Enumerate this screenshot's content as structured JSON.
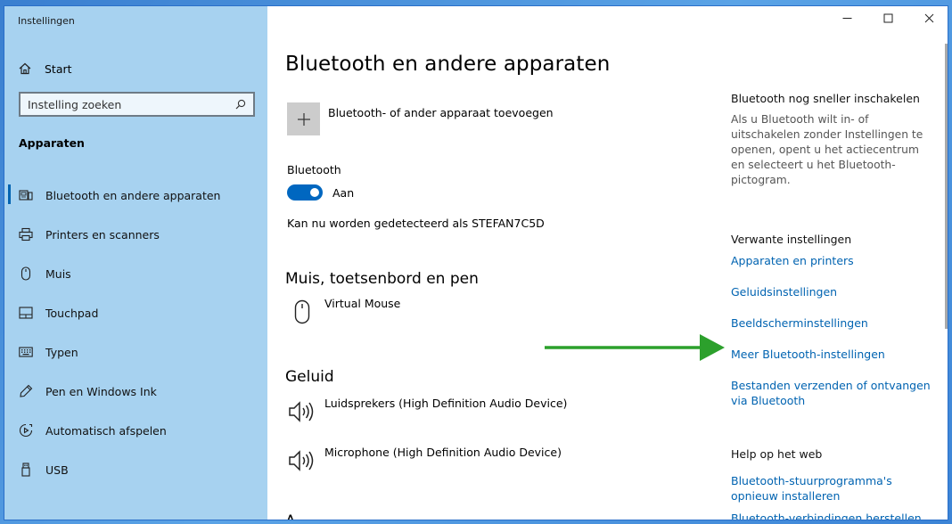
{
  "window": {
    "app_title": "Instellingen",
    "controls": {
      "minimize_icon": "minimize-icon",
      "maximize_icon": "maximize-icon",
      "close_icon": "close-icon"
    }
  },
  "sidebar": {
    "home_label": "Start",
    "search_placeholder": "Instelling zoeken",
    "section": "Apparaten",
    "items": [
      {
        "label": "Bluetooth en andere apparaten",
        "icon": "bluetooth-devices-icon",
        "active": true
      },
      {
        "label": "Printers en scanners",
        "icon": "printer-icon",
        "active": false
      },
      {
        "label": "Muis",
        "icon": "mouse-icon",
        "active": false
      },
      {
        "label": "Touchpad",
        "icon": "touchpad-icon",
        "active": false
      },
      {
        "label": "Typen",
        "icon": "keyboard-icon",
        "active": false
      },
      {
        "label": "Pen en Windows Ink",
        "icon": "pen-icon",
        "active": false
      },
      {
        "label": "Automatisch afspelen",
        "icon": "autoplay-icon",
        "active": false
      },
      {
        "label": "USB",
        "icon": "usb-icon",
        "active": false
      }
    ]
  },
  "main": {
    "title": "Bluetooth en andere apparaten",
    "add_device_label": "Bluetooth- of ander apparaat toevoegen",
    "bluetooth_label": "Bluetooth",
    "bluetooth_state": "Aan",
    "discoverable_text": "Kan nu worden gedetecteerd als STEFAN7C5D",
    "groups": {
      "input_title": "Muis, toetsenbord en pen",
      "input_devices": [
        "Virtual Mouse"
      ],
      "audio_title": "Geluid",
      "audio_devices": [
        "Luidsprekers (High Definition Audio Device)",
        "Microphone (High Definition Audio Device)"
      ],
      "next_title": "A"
    }
  },
  "right": {
    "quick_heading": "Bluetooth nog sneller inschakelen",
    "quick_text": "Als u Bluetooth wilt in- of uitschakelen zonder Instellingen te openen, opent u het actiecentrum en selecteert u het Bluetooth-pictogram.",
    "related_heading": "Verwante instellingen",
    "related_links": [
      "Apparaten en printers",
      "Geluidsinstellingen",
      "Beeldscherminstellingen",
      "Meer Bluetooth-instellingen",
      "Bestanden verzenden of ontvangen via Bluetooth"
    ],
    "help_heading": "Help op het web",
    "help_links": [
      "Bluetooth-stuurprogramma's opnieuw installeren",
      "Bluetooth-verbindingen herstellen"
    ]
  },
  "colors": {
    "accent": "#0067c0",
    "link": "#0063b1",
    "annotation_arrow": "#2ca02c"
  }
}
